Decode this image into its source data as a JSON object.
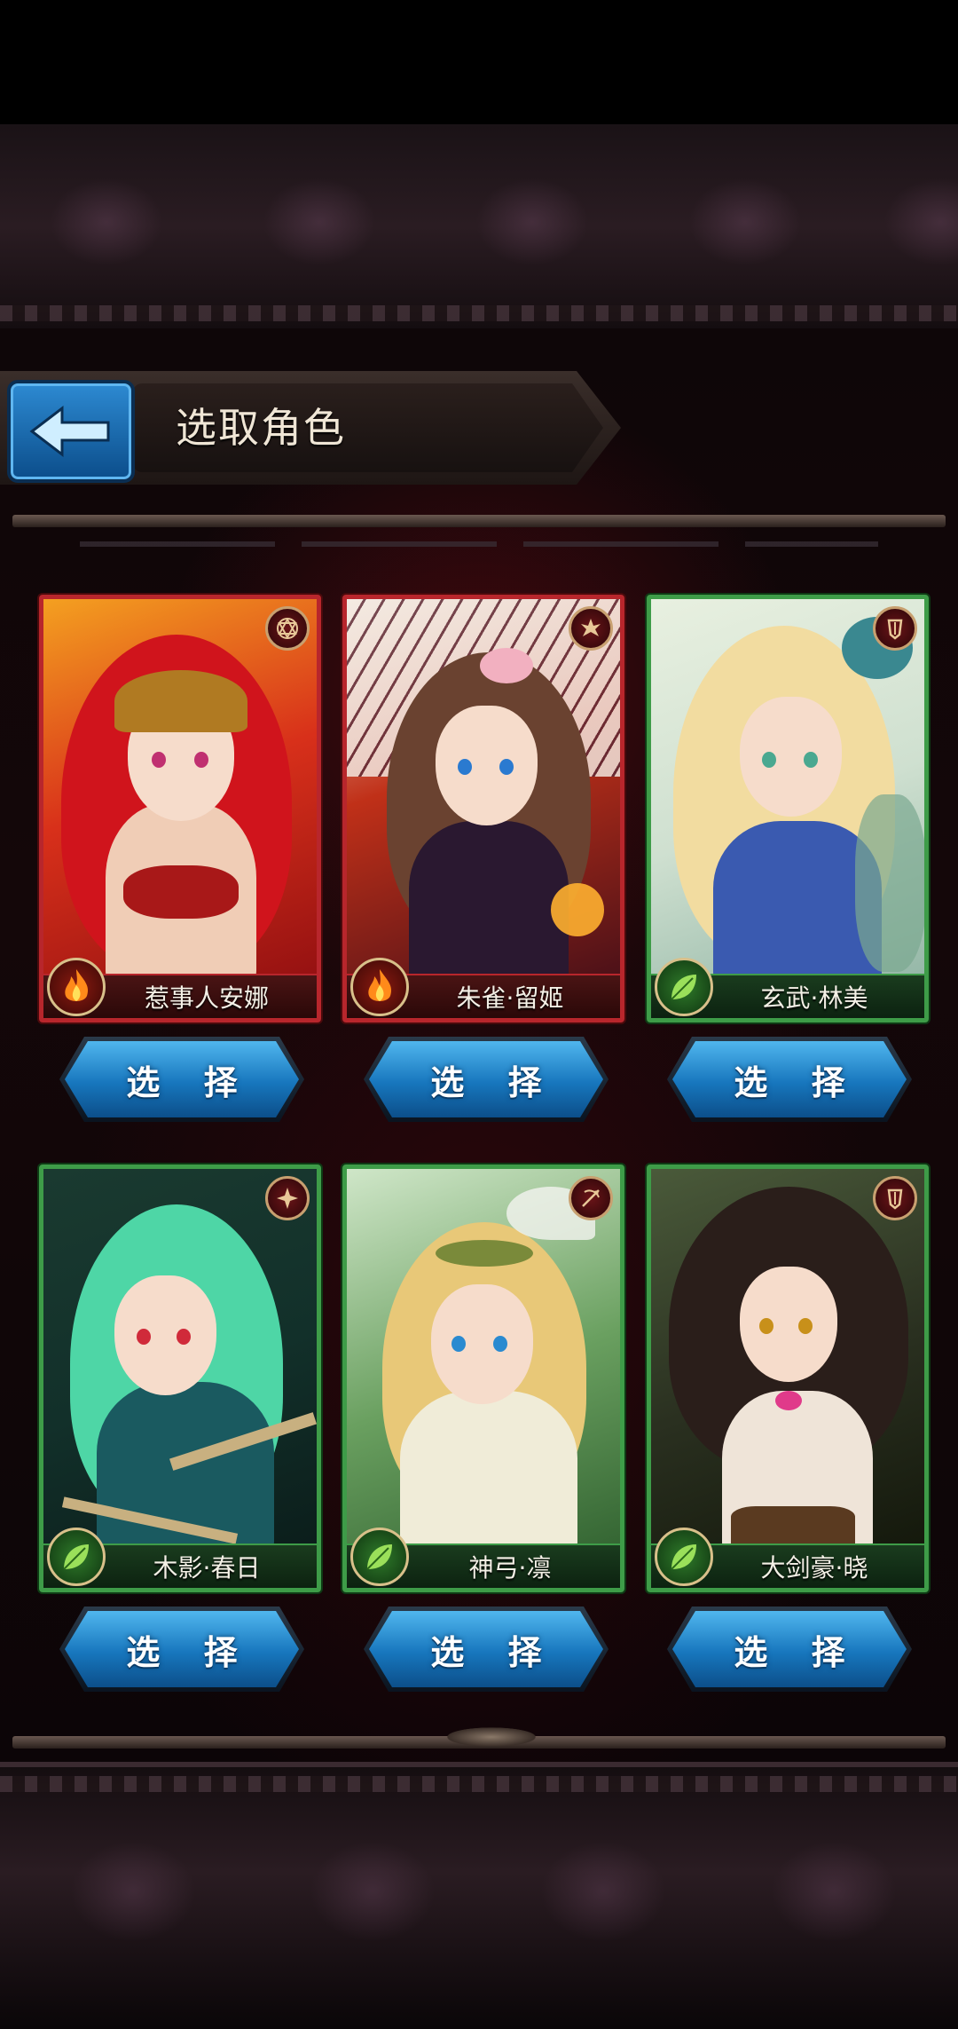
{
  "header": {
    "title": "选取角色",
    "back_icon": "back-arrow-icon"
  },
  "colors": {
    "fire_frame": "#b8262c",
    "wood_frame": "#3e9c48",
    "button_blue": "#1776bd"
  },
  "characters": [
    {
      "name": "惹事人安娜",
      "element": "fire",
      "select_label": "选 择"
    },
    {
      "name": "朱雀·留姬",
      "element": "fire",
      "select_label": "选 择"
    },
    {
      "name": "玄武·林美",
      "element": "wood",
      "select_label": "选 择"
    },
    {
      "name": "木影·春日",
      "element": "wood",
      "select_label": "选 择"
    },
    {
      "name": "神弓·凛",
      "element": "wood",
      "select_label": "选 择"
    },
    {
      "name": "大剑豪·晓",
      "element": "wood",
      "select_label": "选 择"
    }
  ]
}
